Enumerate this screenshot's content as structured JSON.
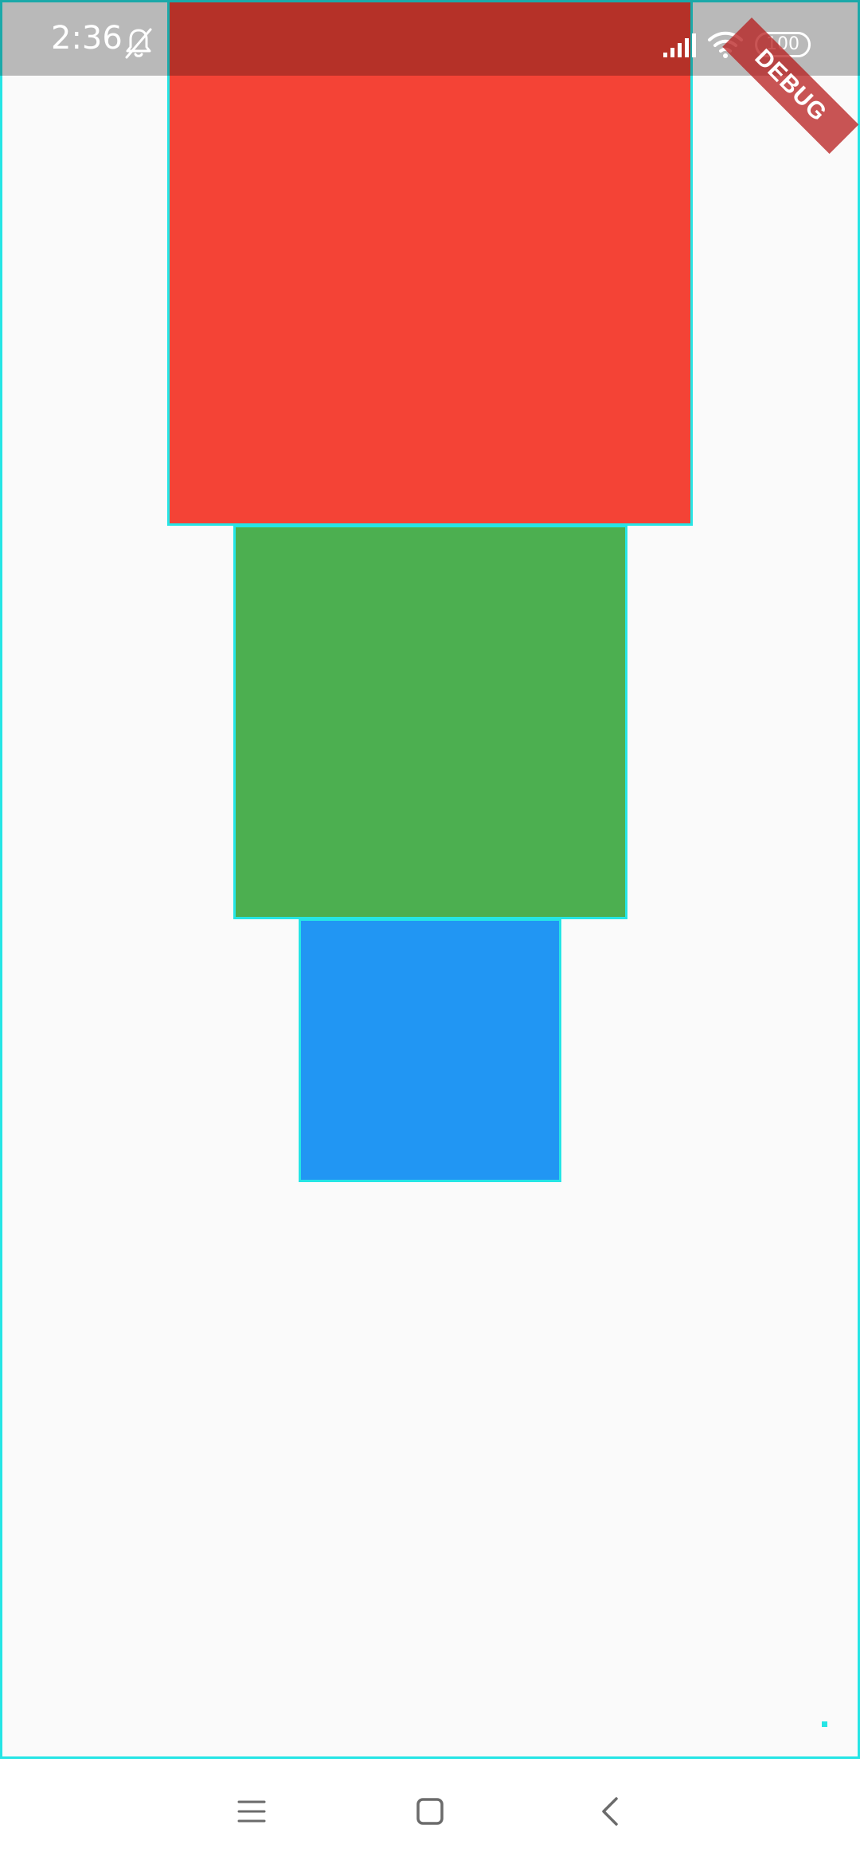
{
  "status_bar": {
    "time": "2:36",
    "battery": "100",
    "icons": [
      "bell-off-icon",
      "signal-icon",
      "wifi-icon",
      "battery-icon"
    ]
  },
  "debug_banner": {
    "label": "DEBUG",
    "color": "#b71c1c"
  },
  "boxes": [
    {
      "name": "red-box",
      "color": "#f44336"
    },
    {
      "name": "green-box",
      "color": "#4caf50"
    },
    {
      "name": "blue-box",
      "color": "#2196f3"
    }
  ],
  "debug_outline_color": "#25e5e5",
  "nav_bar": {
    "icons": [
      "menu-icon",
      "home-icon",
      "back-icon"
    ]
  }
}
